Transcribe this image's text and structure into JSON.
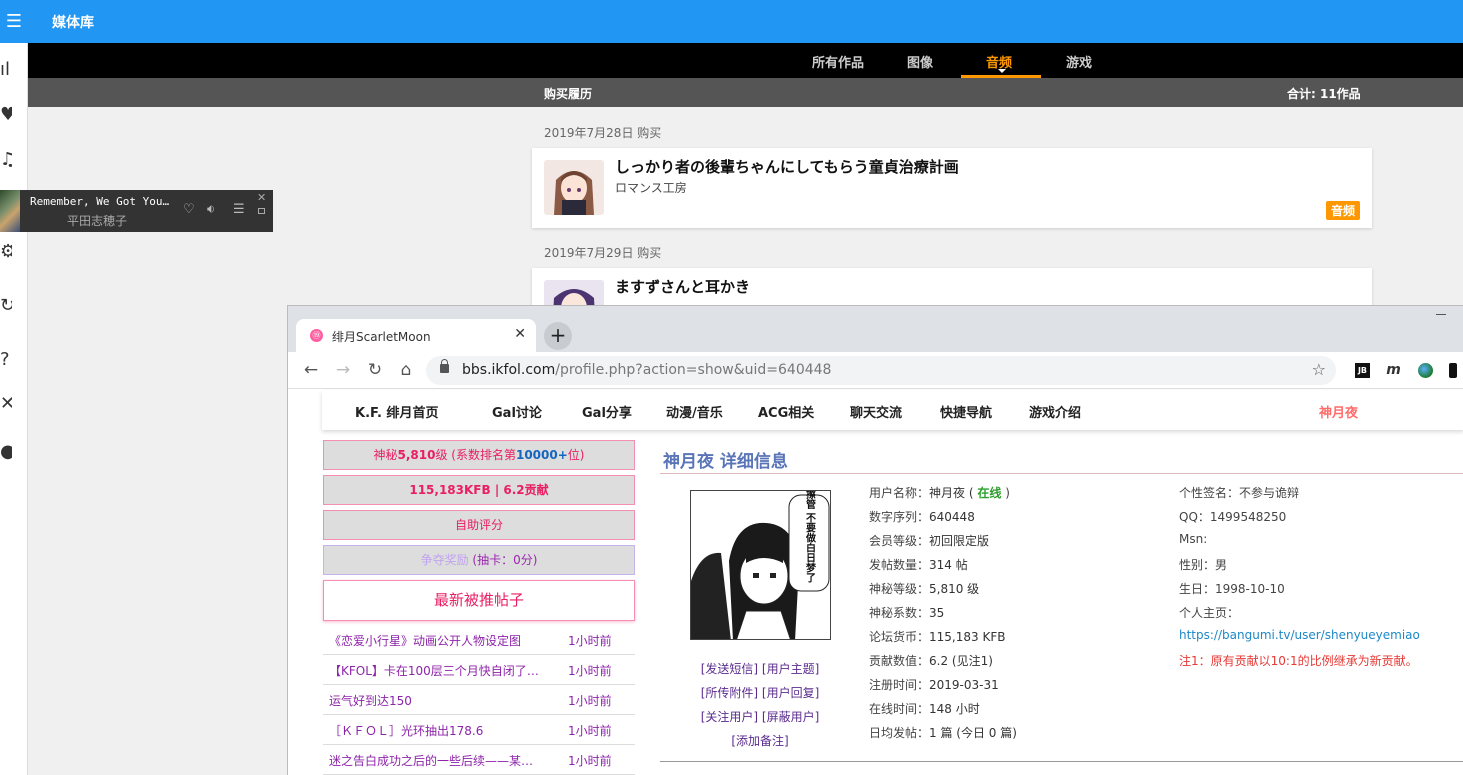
{
  "media_app": {
    "title": "媒体库",
    "tabs": [
      "所有作品",
      "图像",
      "音频",
      "游戏"
    ],
    "active_tab": "音频",
    "purchase_history_label": "购买履历",
    "total_label": "合计: 11作品",
    "purchases": [
      {
        "date": "2019年7月28日 购买",
        "title": "しっかり者の後輩ちゃんにしてもらう童貞治療計画",
        "circle": "ロマンス工房",
        "badge": "音频"
      },
      {
        "date": "2019年7月29日 购买",
        "title": "ますずさんと耳かき",
        "circle": ""
      }
    ]
  },
  "sidebar_icons": [
    "menu-icon",
    "stats-icon",
    "heart-icon",
    "music-icon",
    "settings-icon",
    "refresh-icon",
    "help-icon",
    "close-icon",
    "user-icon"
  ],
  "mini_player": {
    "song": "Remember, We Got You…",
    "artist": "平田志穂子"
  },
  "browser": {
    "tab_title": "绯月ScarletMoon",
    "url_host": "bbs.ikfol.com",
    "url_path": "/profile.php?action=show&uid=640448",
    "extensions": [
      "JB",
      "m"
    ]
  },
  "site": {
    "nav": [
      "K.F. 绯月首页",
      "Gal讨论",
      "Gal分享",
      "动漫/音乐",
      "ACG相关",
      "聊天交流",
      "快捷导航",
      "游戏介绍"
    ],
    "username_nav": "神月夜",
    "stats": {
      "mystery_prefix": "神秘",
      "mystery_level": "5,810",
      "mystery_mid": "级 (系数排名第",
      "mystery_rank": "10000+",
      "mystery_suffix": "位)",
      "kfb_part": "115,183KFB | 6.2贡献",
      "self_rate": "自助评分",
      "contest_prefix": "争夺奖励",
      "contest_suffix": "(抽卡：0分)"
    },
    "hot_posts_title": "最新被推帖子",
    "hot_posts": [
      {
        "title": "《恋爱小行星》动画公开人物设定图",
        "time": "1小时前"
      },
      {
        "title": "【KFOL】卡在100层三个月快自闭了，…",
        "time": "1小时前"
      },
      {
        "title": "运气好到达150",
        "time": "1小时前"
      },
      {
        "title": "［ＫＦＯＬ］光环抽出178.6",
        "time": "1小时前"
      },
      {
        "title": "迷之告白成功之后的一些后续——某脚…",
        "time": "1小时前"
      }
    ],
    "profile_heading": "神月夜 详细信息",
    "avatar_caption": "年轻人好好擦管 不要做白日梦了",
    "avatar_links": [
      "[发送短信]",
      "[用户主题]",
      "[所传附件]",
      "[用户回复]",
      "[关注用户]",
      "[屏蔽用户]",
      "[添加备注]"
    ],
    "info": [
      {
        "label": "用户名称：",
        "value": "神月夜 ("
      },
      {
        "label": "数字序列：",
        "value": "640448"
      },
      {
        "label": "会员等级：",
        "value": "初回限定版"
      },
      {
        "label": "发帖数量：",
        "value": "314 帖"
      },
      {
        "label": "神秘等级：",
        "value": "5,810 级"
      },
      {
        "label": "神秘系数：",
        "value": "35"
      },
      {
        "label": "论坛货币：",
        "value": "115,183 KFB"
      },
      {
        "label": "贡献数值：",
        "value": "6.2 (见注1)"
      },
      {
        "label": "注册时间：",
        "value": "2019-03-31"
      },
      {
        "label": "在线时间：",
        "value": "148 小时"
      },
      {
        "label": "日均发帖：",
        "value": "1 篇 (今日 0 篇)"
      }
    ],
    "online_status": "在线",
    "info_close": ")",
    "info2": [
      {
        "label": "个性签名：",
        "value": "不参与诡辩"
      },
      {
        "label": "QQ：",
        "value": "1499548250"
      },
      {
        "label": "Msn:",
        "value": ""
      },
      {
        "label": "性别：",
        "value": "男"
      },
      {
        "label": "生日：",
        "value": "1998-10-10"
      },
      {
        "label": "个人主页：",
        "value": ""
      }
    ],
    "homepage_url": "https://bangumi.tv/user/shenyueyemiao",
    "note": "注1：原有贡献以10:1的比例继承为新贡献。"
  }
}
